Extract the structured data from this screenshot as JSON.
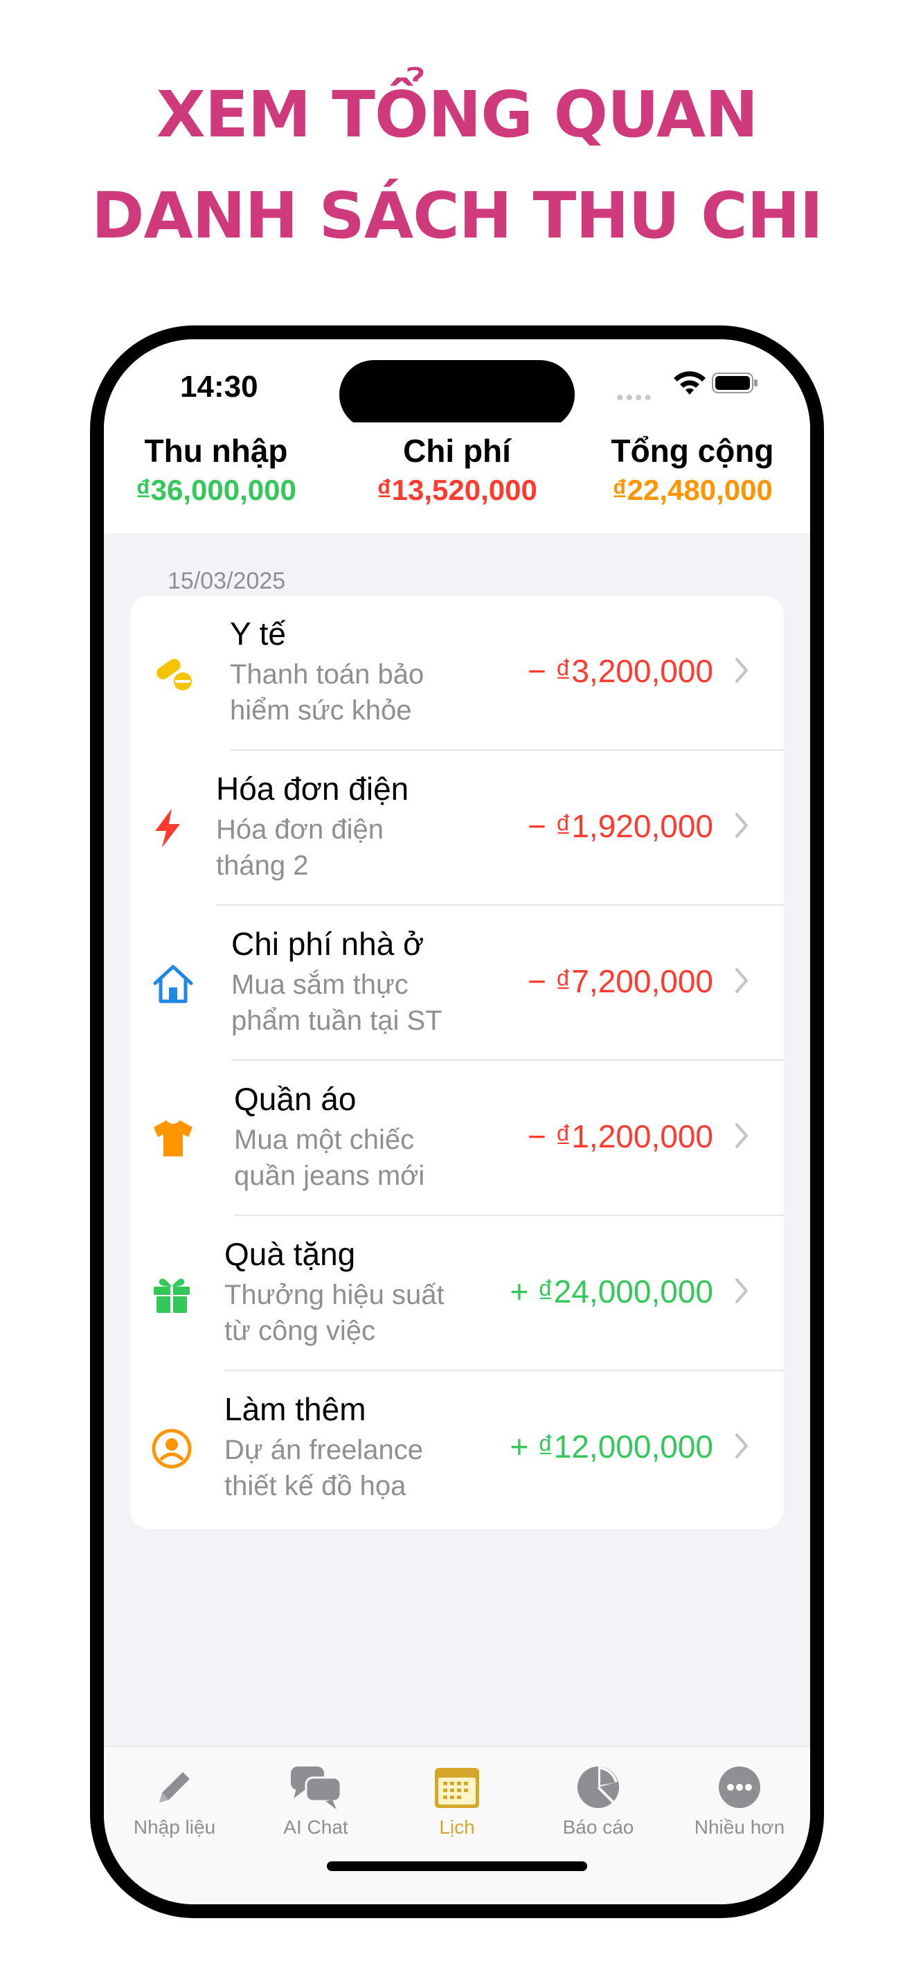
{
  "headline": {
    "line1": "XEM TỔNG QUAN",
    "line2": "DANH SÁCH THU CHI"
  },
  "status_bar": {
    "time": "14:30",
    "signal_dots": "••••",
    "icons": [
      "wifi-icon",
      "battery-icon"
    ]
  },
  "summary": {
    "income": {
      "label": "Thu nhập",
      "value": "₫36,000,000",
      "color": "#34c759"
    },
    "expense": {
      "label": "Chi phí",
      "value": "₫13,520,000",
      "color": "#ff3b30"
    },
    "total": {
      "label": "Tổng cộng",
      "value": "₫22,480,000",
      "color": "#ff9500"
    }
  },
  "list": {
    "date": "15/03/2025",
    "items": [
      {
        "title": "Y tế",
        "desc1": "Thanh toán bảo",
        "desc2": "hiểm sức khỏe",
        "amount": "−  ₫3,200,000",
        "type": "expense",
        "icon": "pills-icon"
      },
      {
        "title": "Hóa đơn điện",
        "desc1": "Hóa đơn điện",
        "desc2": "tháng 2",
        "amount": "−  ₫1,920,000",
        "type": "expense",
        "icon": "lightning-icon"
      },
      {
        "title": "Chi phí nhà ở",
        "desc1": "Mua sắm thực",
        "desc2": "phẩm tuần tại ST",
        "amount": "−  ₫7,200,000",
        "type": "expense",
        "icon": "house-icon"
      },
      {
        "title": "Quần áo",
        "desc1": "Mua một chiếc",
        "desc2": "quần jeans mới",
        "amount": "−  ₫1,200,000",
        "type": "expense",
        "icon": "tshirt-icon"
      },
      {
        "title": "Quà tặng",
        "desc1": "Thưởng hiệu suất",
        "desc2": "từ công việc",
        "amount": "+  ₫24,000,000",
        "type": "income",
        "icon": "gift-icon"
      },
      {
        "title": "Làm thêm",
        "desc1": "Dự án freelance",
        "desc2": "thiết kế đồ họa",
        "amount": "+  ₫12,000,000",
        "type": "income",
        "icon": "person-circle-icon"
      }
    ]
  },
  "tabbar": {
    "active_color": "#d4a62a",
    "tabs": [
      {
        "label": "Nhập liệu",
        "icon": "pencil-icon"
      },
      {
        "label": "AI Chat",
        "icon": "chat-bubbles-icon"
      },
      {
        "label": "Lịch",
        "icon": "calendar-icon",
        "active": true
      },
      {
        "label": "Báo cáo",
        "icon": "pie-chart-icon"
      },
      {
        "label": "Nhiều hơn",
        "icon": "more-icon"
      }
    ]
  }
}
